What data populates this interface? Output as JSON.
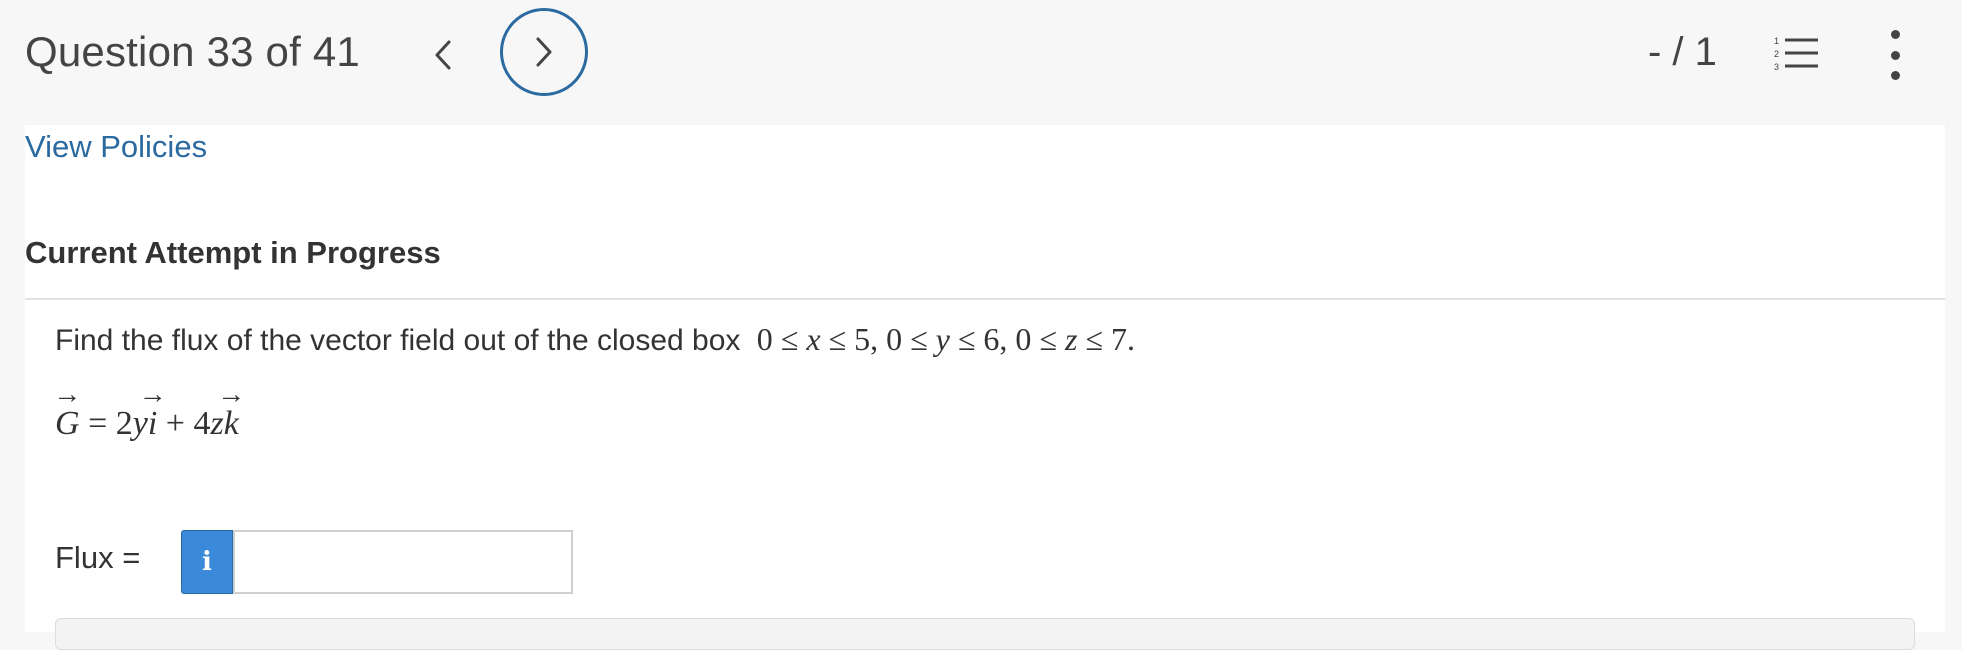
{
  "header": {
    "question_label": "Question 33 of 41",
    "score": "- / 1",
    "icons": {
      "prev": "chevron-left-icon",
      "next": "chevron-right-icon",
      "list": "numbered-list-icon",
      "more": "more-vertical-icon"
    },
    "accent_color": "#2a6aa0"
  },
  "content": {
    "view_policies": "View Policies",
    "attempt_heading": "Current Attempt in Progress",
    "question_text": "Find the flux of the vector field out of the closed box",
    "box": {
      "x_upper": "5",
      "y_upper": "6",
      "z_upper": "7"
    },
    "field": {
      "name": "G",
      "coef_i": "2",
      "var_i": "y",
      "unit_i": "i",
      "coef_k": "4",
      "var_k": "z",
      "unit_k": "k"
    },
    "flux_label": "Flux",
    "info_button": "i",
    "answer_value": ""
  }
}
